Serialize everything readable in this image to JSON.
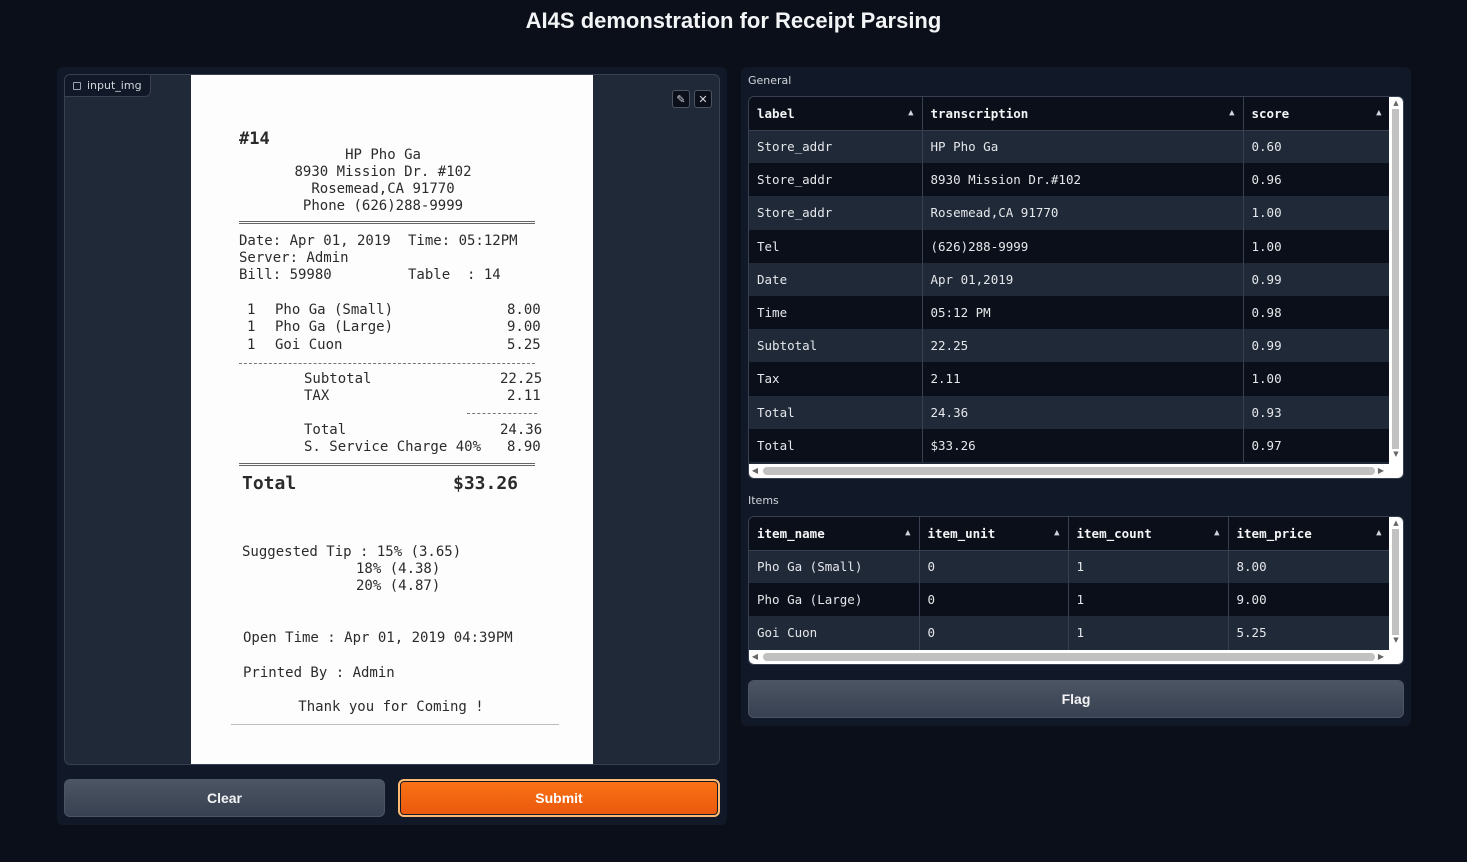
{
  "title": "AI4S demonstration for Receipt Parsing",
  "input_image": {
    "label": "input_img",
    "receipt": {
      "order_no": "#14",
      "store_name": "HP Pho Ga",
      "address1": "8930 Mission Dr. #102",
      "address2": "Rosemead,CA 91770",
      "phone": "Phone (626)288-9999",
      "date": "Date: Apr 01, 2019",
      "time": "Time: 05:12PM",
      "server": "Server: Admin",
      "bill": "Bill: 59980",
      "table": "Table  : 14",
      "items": [
        {
          "qty": "1",
          "name": "Pho Ga (Small)",
          "price": "8.00"
        },
        {
          "qty": "1",
          "name": "Pho Ga (Large)",
          "price": "9.00"
        },
        {
          "qty": "1",
          "name": "Goi Cuon",
          "price": "5.25"
        }
      ],
      "subtotal_label": "Subtotal",
      "subtotal": "22.25",
      "tax_label": "TAX",
      "tax": "2.11",
      "total_label": "Total",
      "total": "24.36",
      "service_label": "S. Service Charge 40%",
      "service": "8.90",
      "grand_label": "Total",
      "grand": "$33.26",
      "tip1": "Suggested Tip : 15% (3.65)",
      "tip2": "18% (4.38)",
      "tip3": "20% (4.87)",
      "open_time": "Open Time : Apr 01, 2019 04:39PM",
      "printed_by": "Printed By : Admin",
      "thanks": "Thank you for Coming !"
    }
  },
  "buttons": {
    "clear": "Clear",
    "submit": "Submit",
    "flag": "Flag"
  },
  "general": {
    "label": "General",
    "columns": [
      "label",
      "transcription",
      "score"
    ],
    "rows": [
      [
        "Store_addr",
        "HP Pho Ga",
        "0.60"
      ],
      [
        "Store_addr",
        "8930 Mission Dr.#102",
        "0.96"
      ],
      [
        "Store_addr",
        "Rosemead,CA 91770",
        "1.00"
      ],
      [
        "Tel",
        "(626)288-9999",
        "1.00"
      ],
      [
        "Date",
        "Apr 01,2019",
        "0.99"
      ],
      [
        "Time",
        "05:12 PM",
        "0.98"
      ],
      [
        "Subtotal",
        "22.25",
        "0.99"
      ],
      [
        "Tax",
        "2.11",
        "1.00"
      ],
      [
        "Total",
        "24.36",
        "0.93"
      ],
      [
        "Total",
        "$33.26",
        "0.97"
      ]
    ]
  },
  "items": {
    "label": "Items",
    "columns": [
      "item_name",
      "item_unit",
      "item_count",
      "item_price"
    ],
    "rows": [
      [
        "Pho Ga (Small)",
        "0",
        "1",
        "8.00"
      ],
      [
        "Pho Ga (Large)",
        "0",
        "1",
        "9.00"
      ],
      [
        "Goi Cuon",
        "0",
        "1",
        "5.25"
      ]
    ]
  },
  "colors": {
    "background": "#0b0f19",
    "panel": "#111827",
    "accent": "#f97316"
  },
  "icons": {
    "edit": "pencil-icon",
    "close": "close-icon",
    "image": "image-icon"
  }
}
